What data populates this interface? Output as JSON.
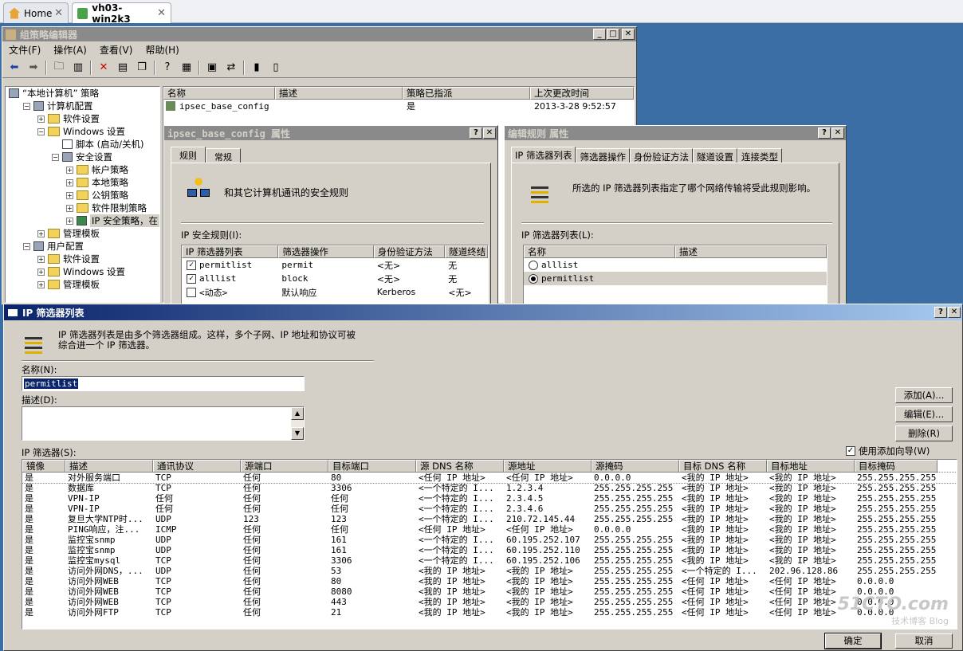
{
  "browser_tabs": [
    {
      "label": "Home"
    },
    {
      "label": "vh03-win2k3"
    }
  ],
  "main_window": {
    "title": "组策略编辑器",
    "menu": [
      "文件(F)",
      "操作(A)",
      "查看(V)",
      "帮助(H)"
    ],
    "tree": [
      {
        "label": "“本地计算机” 策略",
        "level": 0
      },
      {
        "label": "计算机配置",
        "level": 1
      },
      {
        "label": "软件设置",
        "level": 2
      },
      {
        "label": "Windows 设置",
        "level": 2
      },
      {
        "label": "脚本 (启动/关机)",
        "level": 3
      },
      {
        "label": "安全设置",
        "level": 3
      },
      {
        "label": "帐户策略",
        "level": 4
      },
      {
        "label": "本地策略",
        "level": 4
      },
      {
        "label": "公钥策略",
        "level": 4
      },
      {
        "label": "软件限制策略",
        "level": 4
      },
      {
        "label": "IP 安全策略，在",
        "level": 4
      },
      {
        "label": "管理模板",
        "level": 2
      },
      {
        "label": "用户配置",
        "level": 1
      },
      {
        "label": "软件设置",
        "level": 2
      },
      {
        "label": "Windows 设置",
        "level": 2
      },
      {
        "label": "管理模板",
        "level": 2
      }
    ],
    "list_headers": [
      "名称",
      "描述",
      "策略已指派",
      "上次更改时间"
    ],
    "list_rows": [
      {
        "name": "ipsec_base_config",
        "desc": "",
        "assigned": "是",
        "changed": "2013-3-28 9:52:57"
      }
    ]
  },
  "props_dialog": {
    "title": "ipsec_base_config 属性",
    "tabs": [
      "规则",
      "常规"
    ],
    "description": "和其它计算机通讯的安全规则",
    "rules_label": "IP 安全规则(I):",
    "headers": [
      "IP 筛选器列表",
      "筛选器操作",
      "身份验证方法",
      "隧道终结"
    ],
    "rows": [
      {
        "checked": true,
        "list": "permitlist",
        "action": "permit",
        "auth": "<无>",
        "tunnel": "无"
      },
      {
        "checked": true,
        "list": "alllist",
        "action": "block",
        "auth": "<无>",
        "tunnel": "无"
      },
      {
        "checked": false,
        "list": "<动态>",
        "action": "默认响应",
        "auth": "Kerberos",
        "tunnel": "<无>"
      }
    ]
  },
  "edit_rule_dialog": {
    "title": "编辑规则 属性",
    "tabs": [
      "IP 筛选器列表",
      "筛选器操作",
      "身份验证方法",
      "隧道设置",
      "连接类型"
    ],
    "description": "所选的 IP 筛选器列表指定了哪个网络传输将受此规则影响。",
    "list_label": "IP 筛选器列表(L):",
    "headers": [
      "名称",
      "描述"
    ],
    "rows": [
      {
        "name": "alllist",
        "selected": false
      },
      {
        "name": "permitlist",
        "selected": true
      }
    ]
  },
  "filter_dialog": {
    "title": "IP 筛选器列表",
    "description_line1": "IP 筛选器列表是由多个筛选器组成。这样，多个子网、IP 地址和协议可被",
    "description_line2": "综合进一个 IP 筛选器。",
    "name_label": "名称(N):",
    "name_value": "permitlist",
    "desc_label": "描述(D):",
    "desc_value": "",
    "buttons": {
      "add": "添加(A)...",
      "edit": "编辑(E)...",
      "remove": "删除(R)",
      "ok": "确定",
      "cancel": "取消"
    },
    "wizard_label": "使用添加向导(W)",
    "wizard_checked": true,
    "filters_label": "IP 筛选器(S):",
    "headers": [
      "镜像",
      "描述",
      "通讯协议",
      "源端口",
      "目标端口",
      "源 DNS 名称",
      "源地址",
      "源掩码",
      "目标 DNS 名称",
      "目标地址",
      "目标掩码"
    ],
    "rows": [
      [
        "是",
        "对外服务端口",
        "TCP",
        "任何",
        "80",
        "<任何 IP 地址>",
        "<任何 IP 地址>",
        "0.0.0.0",
        "<我的 IP 地址>",
        "<我的 IP 地址>",
        "255.255.255.255"
      ],
      [
        "是",
        "数据库",
        "TCP",
        "任何",
        "3306",
        "<一个特定的 I...",
        "1.2.3.4",
        "255.255.255.255",
        "<我的 IP 地址>",
        "<我的 IP 地址>",
        "255.255.255.255"
      ],
      [
        "是",
        "VPN-IP",
        "任何",
        "任何",
        "任何",
        "<一个特定的 I...",
        "2.3.4.5",
        "255.255.255.255",
        "<我的 IP 地址>",
        "<我的 IP 地址>",
        "255.255.255.255"
      ],
      [
        "是",
        "VPN-IP",
        "任何",
        "任何",
        "任何",
        "<一个特定的 I...",
        "2.3.4.6",
        "255.255.255.255",
        "<我的 IP 地址>",
        "<我的 IP 地址>",
        "255.255.255.255"
      ],
      [
        "是",
        "复旦大学NTP时...",
        "UDP",
        "123",
        "123",
        "<一个特定的 I...",
        "210.72.145.44",
        "255.255.255.255",
        "<我的 IP 地址>",
        "<我的 IP 地址>",
        "255.255.255.255"
      ],
      [
        "是",
        "PING响应，注...",
        "ICMP",
        "任何",
        "任何",
        "<任何 IP 地址>",
        "<任何 IP 地址>",
        "0.0.0.0",
        "<我的 IP 地址>",
        "<我的 IP 地址>",
        "255.255.255.255"
      ],
      [
        "是",
        "监控宝snmp",
        "UDP",
        "任何",
        "161",
        "<一个特定的 I...",
        "60.195.252.107",
        "255.255.255.255",
        "<我的 IP 地址>",
        "<我的 IP 地址>",
        "255.255.255.255"
      ],
      [
        "是",
        "监控宝snmp",
        "UDP",
        "任何",
        "161",
        "<一个特定的 I...",
        "60.195.252.110",
        "255.255.255.255",
        "<我的 IP 地址>",
        "<我的 IP 地址>",
        "255.255.255.255"
      ],
      [
        "是",
        "监控宝mysql",
        "TCP",
        "任何",
        "3306",
        "<一个特定的 I...",
        "60.195.252.106",
        "255.255.255.255",
        "<我的 IP 地址>",
        "<我的 IP 地址>",
        "255.255.255.255"
      ],
      [
        "是",
        "访问外网DNS，...",
        "UDP",
        "任何",
        "53",
        "<我的 IP 地址>",
        "<我的 IP 地址>",
        "255.255.255.255",
        "<一个特定的 I...",
        "202.96.128.86",
        "255.255.255.255"
      ],
      [
        "是",
        "访问外网WEB",
        "TCP",
        "任何",
        "80",
        "<我的 IP 地址>",
        "<我的 IP 地址>",
        "255.255.255.255",
        "<任何 IP 地址>",
        "<任何 IP 地址>",
        "0.0.0.0"
      ],
      [
        "是",
        "访问外网WEB",
        "TCP",
        "任何",
        "8080",
        "<我的 IP 地址>",
        "<我的 IP 地址>",
        "255.255.255.255",
        "<任何 IP 地址>",
        "<任何 IP 地址>",
        "0.0.0.0"
      ],
      [
        "是",
        "访问外网WEB",
        "TCP",
        "任何",
        "443",
        "<我的 IP 地址>",
        "<我的 IP 地址>",
        "255.255.255.255",
        "<任何 IP 地址>",
        "<任何 IP 地址>",
        "0.0.0.0"
      ],
      [
        "是",
        "访问外网FTP",
        "TCP",
        "任何",
        "21",
        "<我的 IP 地址>",
        "<我的 IP 地址>",
        "255.255.255.255",
        "<任何 IP 地址>",
        "<任何 IP 地址>",
        "0.0.0.0"
      ]
    ]
  },
  "watermark": {
    "line1": "51CTO.com",
    "line2": "技术博客 Blog"
  }
}
